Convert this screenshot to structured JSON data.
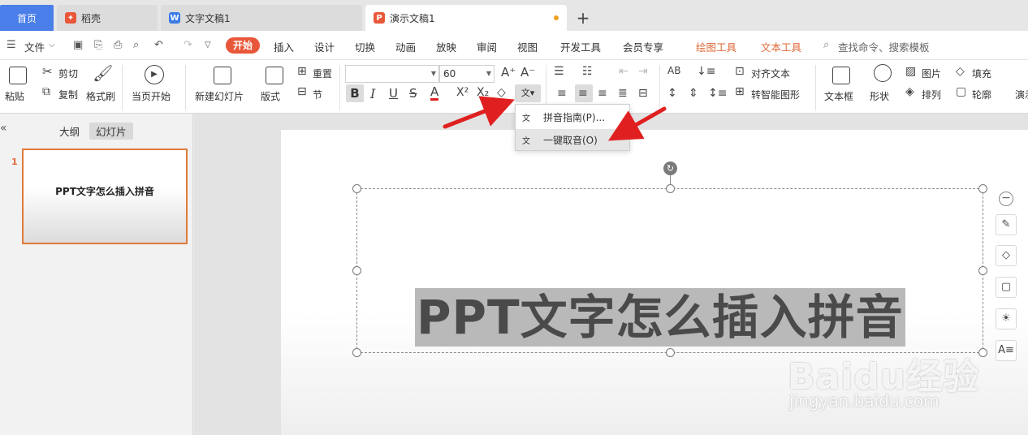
{
  "tabs": {
    "home": "首页",
    "daoke": "稻壳",
    "writer": "文字文稿1",
    "presentation": "演示文稿1",
    "add": "+"
  },
  "menu": {
    "file": "文件",
    "start": "开始",
    "insert": "插入",
    "design": "设计",
    "transition": "切换",
    "animation": "动画",
    "slideshow": "放映",
    "review": "审阅",
    "view": "视图",
    "developer": "开发工具",
    "member": "会员专享",
    "drawing_tools": "绘图工具",
    "text_tools": "文本工具",
    "search": "查找命令、搜索模板"
  },
  "ribbon": {
    "paste": "粘贴",
    "cut": "剪切",
    "copy": "复制",
    "format_painter": "格式刷",
    "from_current": "当页开始",
    "new_slide": "新建幻灯片",
    "layout": "版式",
    "reset": "重置",
    "section": "节",
    "font_name": "",
    "font_size": "60",
    "align_text": "对齐文本",
    "smart_graphic": "转智能图形",
    "textbox": "文本框",
    "shape": "形状",
    "picture": "图片",
    "arrange": "排列",
    "fill": "填充",
    "outline": "轮廓",
    "more": "演示"
  },
  "dropdown": {
    "item1": "拼音指南(P)...",
    "item2": "一键取音(O)"
  },
  "left_panel": {
    "outline_tab": "大纲",
    "slides_tab": "幻灯片",
    "slide_number": "1",
    "thumb_title": "PPT文字怎么插入拼音"
  },
  "slide": {
    "title": "PPT文字怎么插入拼音"
  },
  "watermark": {
    "brand": "Baidu经验",
    "url": "jingyan.baidu.com"
  },
  "colors": {
    "accent": "#e9573a",
    "home_tab": "#4a7ee8",
    "arrow": "#e02020"
  }
}
